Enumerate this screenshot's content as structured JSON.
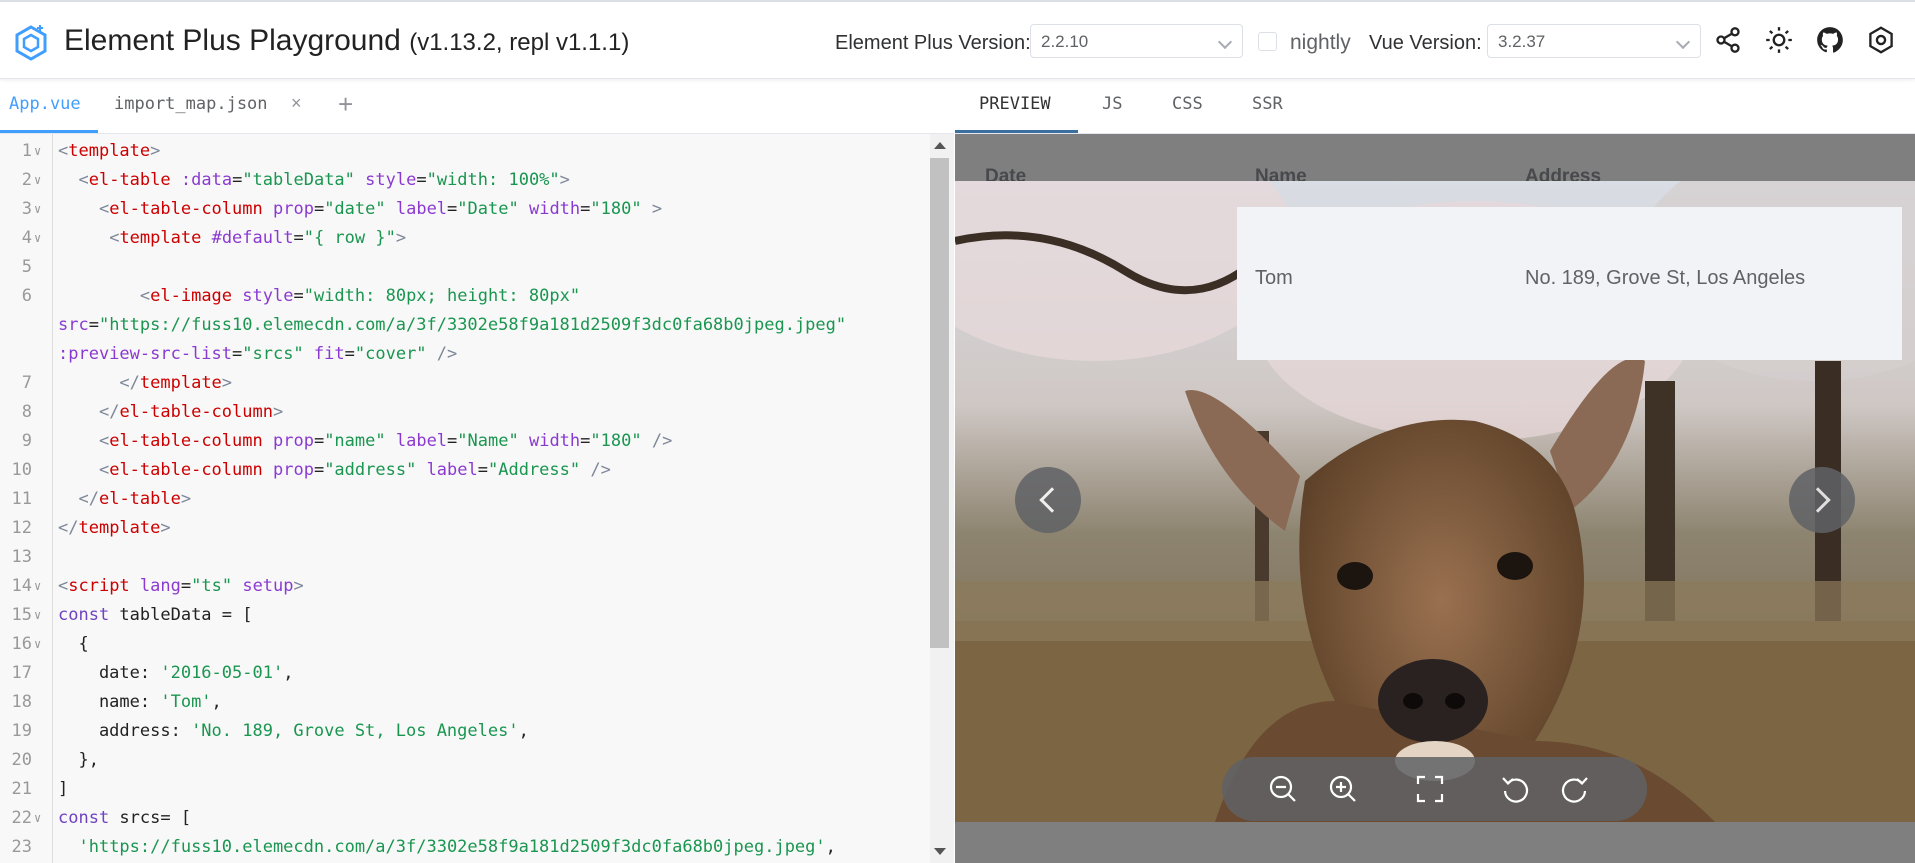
{
  "header": {
    "title": "Element Plus Playground",
    "version": "(v1.13.2, repl v1.1.1)",
    "ep_version_label": "Element Plus Version:",
    "ep_version_value": "2.2.10",
    "nightly_label": "nightly",
    "vue_version_label": "Vue Version:",
    "vue_version_value": "3.2.37",
    "icons": [
      "share-icon",
      "sun-icon",
      "github-icon",
      "settings-icon"
    ]
  },
  "editor": {
    "tabs": [
      {
        "label": "App.vue",
        "active": true
      },
      {
        "label": "import_map.json",
        "active": false
      }
    ],
    "close_symbol": "×",
    "add_symbol": "+",
    "lines": [
      {
        "n": "1",
        "fold": true,
        "tokens": [
          [
            "punc",
            "<"
          ],
          [
            "tag",
            "template"
          ],
          [
            "punc",
            ">"
          ]
        ]
      },
      {
        "n": "2",
        "fold": true,
        "tokens": [
          [
            "plain",
            "  "
          ],
          [
            "punc",
            "<"
          ],
          [
            "tag",
            "el-table"
          ],
          [
            "plain",
            " "
          ],
          [
            "attr",
            ":data"
          ],
          [
            "plain",
            "="
          ],
          [
            "str",
            "\"tableData\""
          ],
          [
            "plain",
            " "
          ],
          [
            "attr",
            "style"
          ],
          [
            "plain",
            "="
          ],
          [
            "str",
            "\"width: 100%\""
          ],
          [
            "punc",
            ">"
          ]
        ]
      },
      {
        "n": "3",
        "fold": true,
        "tokens": [
          [
            "plain",
            "    "
          ],
          [
            "punc",
            "<"
          ],
          [
            "tag",
            "el-table-column"
          ],
          [
            "plain",
            " "
          ],
          [
            "attr",
            "prop"
          ],
          [
            "plain",
            "="
          ],
          [
            "str",
            "\"date\""
          ],
          [
            "plain",
            " "
          ],
          [
            "attr",
            "label"
          ],
          [
            "plain",
            "="
          ],
          [
            "str",
            "\"Date\""
          ],
          [
            "plain",
            " "
          ],
          [
            "attr",
            "width"
          ],
          [
            "plain",
            "="
          ],
          [
            "str",
            "\"180\""
          ],
          [
            "plain",
            " "
          ],
          [
            "punc",
            ">"
          ]
        ]
      },
      {
        "n": "4",
        "fold": true,
        "tokens": [
          [
            "plain",
            "     "
          ],
          [
            "punc",
            "<"
          ],
          [
            "tag",
            "template"
          ],
          [
            "plain",
            " "
          ],
          [
            "attr",
            "#default"
          ],
          [
            "plain",
            "="
          ],
          [
            "str",
            "\"{ row }\""
          ],
          [
            "punc",
            ">"
          ]
        ]
      },
      {
        "n": "5",
        "fold": false,
        "tokens": []
      },
      {
        "n": "6",
        "fold": false,
        "tokens": [
          [
            "plain",
            "        "
          ],
          [
            "punc",
            "<"
          ],
          [
            "tag",
            "el-image"
          ],
          [
            "plain",
            " "
          ],
          [
            "attr",
            "style"
          ],
          [
            "plain",
            "="
          ],
          [
            "str",
            "\"width: 80px; height: 80px\""
          ]
        ]
      },
      {
        "n": "",
        "fold": false,
        "tokens": [
          [
            "attr",
            "src"
          ],
          [
            "plain",
            "="
          ],
          [
            "str",
            "\"https://fuss10.elemecdn.com/a/3f/3302e58f9a181d2509f3dc0fa68b0jpeg.jpeg\""
          ]
        ]
      },
      {
        "n": "",
        "fold": false,
        "tokens": [
          [
            "attr",
            ":preview-src-list"
          ],
          [
            "plain",
            "="
          ],
          [
            "str",
            "\"srcs\""
          ],
          [
            "plain",
            " "
          ],
          [
            "attr",
            "fit"
          ],
          [
            "plain",
            "="
          ],
          [
            "str",
            "\"cover\""
          ],
          [
            "plain",
            " "
          ],
          [
            "punc",
            "/>"
          ]
        ]
      },
      {
        "n": "7",
        "fold": false,
        "tokens": [
          [
            "plain",
            "      "
          ],
          [
            "punc",
            "</"
          ],
          [
            "tag",
            "template"
          ],
          [
            "punc",
            ">"
          ]
        ]
      },
      {
        "n": "8",
        "fold": false,
        "tokens": [
          [
            "plain",
            "    "
          ],
          [
            "punc",
            "</"
          ],
          [
            "tag",
            "el-table-column"
          ],
          [
            "punc",
            ">"
          ]
        ]
      },
      {
        "n": "9",
        "fold": false,
        "tokens": [
          [
            "plain",
            "    "
          ],
          [
            "punc",
            "<"
          ],
          [
            "tag",
            "el-table-column"
          ],
          [
            "plain",
            " "
          ],
          [
            "attr",
            "prop"
          ],
          [
            "plain",
            "="
          ],
          [
            "str",
            "\"name\""
          ],
          [
            "plain",
            " "
          ],
          [
            "attr",
            "label"
          ],
          [
            "plain",
            "="
          ],
          [
            "str",
            "\"Name\""
          ],
          [
            "plain",
            " "
          ],
          [
            "attr",
            "width"
          ],
          [
            "plain",
            "="
          ],
          [
            "str",
            "\"180\""
          ],
          [
            "plain",
            " "
          ],
          [
            "punc",
            "/>"
          ]
        ]
      },
      {
        "n": "10",
        "fold": false,
        "tokens": [
          [
            "plain",
            "    "
          ],
          [
            "punc",
            "<"
          ],
          [
            "tag",
            "el-table-column"
          ],
          [
            "plain",
            " "
          ],
          [
            "attr",
            "prop"
          ],
          [
            "plain",
            "="
          ],
          [
            "str",
            "\"address\""
          ],
          [
            "plain",
            " "
          ],
          [
            "attr",
            "label"
          ],
          [
            "plain",
            "="
          ],
          [
            "str",
            "\"Address\""
          ],
          [
            "plain",
            " "
          ],
          [
            "punc",
            "/>"
          ]
        ]
      },
      {
        "n": "11",
        "fold": false,
        "tokens": [
          [
            "plain",
            "  "
          ],
          [
            "punc",
            "</"
          ],
          [
            "tag",
            "el-table"
          ],
          [
            "punc",
            ">"
          ]
        ]
      },
      {
        "n": "12",
        "fold": false,
        "tokens": [
          [
            "punc",
            "</"
          ],
          [
            "tag",
            "template"
          ],
          [
            "punc",
            ">"
          ]
        ]
      },
      {
        "n": "13",
        "fold": false,
        "tokens": []
      },
      {
        "n": "14",
        "fold": true,
        "tokens": [
          [
            "punc",
            "<"
          ],
          [
            "tag",
            "script"
          ],
          [
            "plain",
            " "
          ],
          [
            "attr",
            "lang"
          ],
          [
            "plain",
            "="
          ],
          [
            "str",
            "\"ts\""
          ],
          [
            "plain",
            " "
          ],
          [
            "attr",
            "setup"
          ],
          [
            "punc",
            ">"
          ]
        ]
      },
      {
        "n": "15",
        "fold": true,
        "tokens": [
          [
            "kw",
            "const"
          ],
          [
            "plain",
            " tableData = ["
          ]
        ]
      },
      {
        "n": "16",
        "fold": true,
        "tokens": [
          [
            "plain",
            "  {"
          ]
        ]
      },
      {
        "n": "17",
        "fold": false,
        "tokens": [
          [
            "plain",
            "    date: "
          ],
          [
            "str",
            "'2016-05-01'"
          ],
          [
            "plain",
            ","
          ]
        ]
      },
      {
        "n": "18",
        "fold": false,
        "tokens": [
          [
            "plain",
            "    name: "
          ],
          [
            "str",
            "'Tom'"
          ],
          [
            "plain",
            ","
          ]
        ]
      },
      {
        "n": "19",
        "fold": false,
        "tokens": [
          [
            "plain",
            "    address: "
          ],
          [
            "str",
            "'No. 189, Grove St, Los Angeles'"
          ],
          [
            "plain",
            ","
          ]
        ]
      },
      {
        "n": "20",
        "fold": false,
        "tokens": [
          [
            "plain",
            "  },"
          ]
        ]
      },
      {
        "n": "21",
        "fold": false,
        "tokens": [
          [
            "plain",
            "]"
          ]
        ]
      },
      {
        "n": "22",
        "fold": true,
        "tokens": [
          [
            "kw",
            "const"
          ],
          [
            "plain",
            " srcs= ["
          ]
        ]
      },
      {
        "n": "23",
        "fold": false,
        "tokens": [
          [
            "plain",
            "  "
          ],
          [
            "str",
            "'https://fuss10.elemecdn.com/a/3f/3302e58f9a181d2509f3dc0fa68b0jpeg.jpeg'"
          ],
          [
            "plain",
            ","
          ]
        ]
      }
    ]
  },
  "preview": {
    "tabs": [
      {
        "label": "PREVIEW",
        "active": true
      },
      {
        "label": "JS",
        "active": false
      },
      {
        "label": "CSS",
        "active": false
      },
      {
        "label": "SSR",
        "active": false
      }
    ],
    "table_headers": [
      "Date",
      "Name",
      "Address"
    ],
    "row": {
      "name": "Tom",
      "address": "No. 189, Grove St, Los Angeles"
    },
    "toolbar_icons": [
      "zoom-out-icon",
      "zoom-in-icon",
      "fullscreen-icon",
      "rotate-left-icon",
      "rotate-right-icon"
    ]
  },
  "colors": {
    "accent": "#409eff",
    "preview_tab_underline": "#3b6fa0",
    "overlay": "rgba(0,0,0,0.5)"
  }
}
